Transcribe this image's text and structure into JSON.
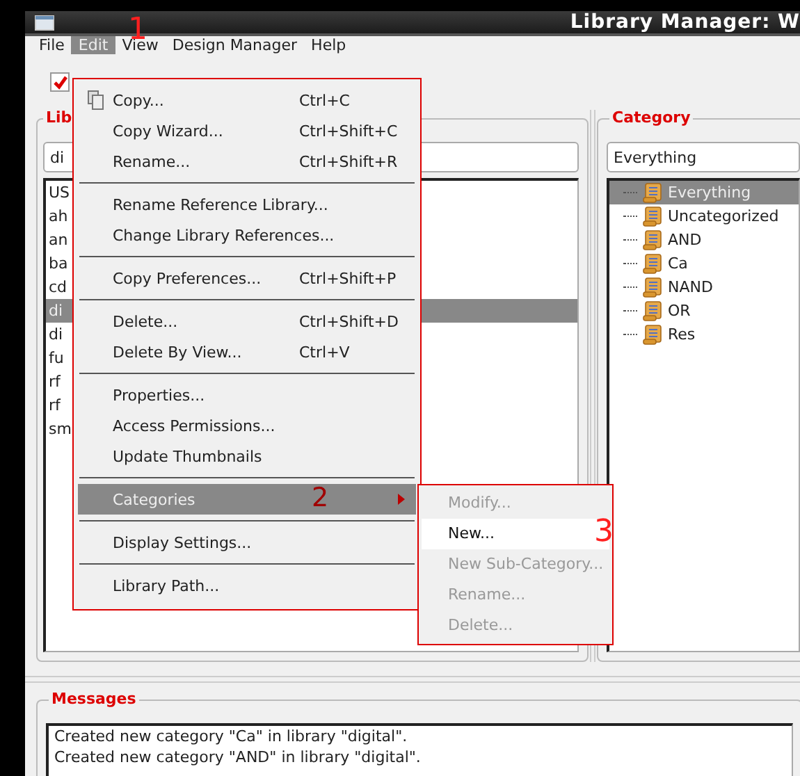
{
  "window": {
    "title": "Library Manager: W"
  },
  "menubar": [
    {
      "label": "File",
      "selected": false
    },
    {
      "label": "Edit",
      "selected": true
    },
    {
      "label": "View",
      "selected": false
    },
    {
      "label": "Design Manager",
      "selected": false
    },
    {
      "label": "Help",
      "selected": false
    }
  ],
  "toolbar": {
    "checked": true
  },
  "library_panel": {
    "title": "Lib",
    "field_value": "di",
    "items": [
      {
        "label": "US",
        "selected": false
      },
      {
        "label": "ah",
        "selected": false
      },
      {
        "label": "an",
        "selected": false
      },
      {
        "label": "ba",
        "selected": false
      },
      {
        "label": "cd",
        "selected": false
      },
      {
        "label": "di",
        "selected": true
      },
      {
        "label": "di",
        "selected": false
      },
      {
        "label": "fu",
        "selected": false
      },
      {
        "label": "rf",
        "selected": false
      },
      {
        "label": "rf",
        "selected": false
      },
      {
        "label": "sm",
        "selected": false
      }
    ]
  },
  "category_panel": {
    "title": "Category",
    "field_value": "Everything",
    "items": [
      {
        "label": "Everything",
        "selected": true
      },
      {
        "label": "Uncategorized",
        "selected": false
      },
      {
        "label": "AND",
        "selected": false
      },
      {
        "label": "Ca",
        "selected": false
      },
      {
        "label": "NAND",
        "selected": false
      },
      {
        "label": "OR",
        "selected": false
      },
      {
        "label": "Res",
        "selected": false
      }
    ]
  },
  "edit_menu": [
    {
      "kind": "icon-item",
      "label": "Copy...",
      "shortcut": "Ctrl+C",
      "selected": false
    },
    {
      "kind": "item",
      "label": "Copy Wizard...",
      "shortcut": "Ctrl+Shift+C",
      "selected": false
    },
    {
      "kind": "item",
      "label": "Rename...",
      "shortcut": "Ctrl+Shift+R",
      "selected": false
    },
    {
      "kind": "separator"
    },
    {
      "kind": "item",
      "label": "Rename Reference Library...",
      "selected": false
    },
    {
      "kind": "item",
      "label": "Change Library References...",
      "selected": false
    },
    {
      "kind": "separator"
    },
    {
      "kind": "item",
      "label": "Copy Preferences...",
      "shortcut": "Ctrl+Shift+P",
      "selected": false
    },
    {
      "kind": "separator"
    },
    {
      "kind": "item",
      "label": "Delete...",
      "shortcut": "Ctrl+Shift+D",
      "selected": false
    },
    {
      "kind": "item",
      "label": "Delete By View...",
      "shortcut": "Ctrl+V",
      "selected": false
    },
    {
      "kind": "separator"
    },
    {
      "kind": "item",
      "label": "Properties...",
      "selected": false
    },
    {
      "kind": "item",
      "label": "Access Permissions...",
      "selected": false
    },
    {
      "kind": "item",
      "label": "Update Thumbnails",
      "selected": false
    },
    {
      "kind": "separator"
    },
    {
      "kind": "submenu",
      "label": "Categories",
      "selected": true
    },
    {
      "kind": "separator"
    },
    {
      "kind": "item",
      "label": "Display Settings...",
      "selected": false
    },
    {
      "kind": "separator"
    },
    {
      "kind": "item",
      "label": "Library Path...",
      "selected": false
    }
  ],
  "categories_submenu": [
    {
      "label": "Modify...",
      "disabled": true,
      "selected": false
    },
    {
      "label": "New...",
      "disabled": false,
      "selected": true
    },
    {
      "label": "New Sub-Category...",
      "disabled": true,
      "selected": false
    },
    {
      "label": "Rename...",
      "disabled": true,
      "selected": false
    },
    {
      "label": "Delete...",
      "disabled": true,
      "selected": false
    }
  ],
  "annotations": [
    "1",
    "2",
    "3"
  ],
  "messages": {
    "title": "Messages",
    "lines": [
      "Created new category \"Ca\" in library \"digital\".",
      "Created new category \"AND\" in library \"digital\"."
    ]
  }
}
